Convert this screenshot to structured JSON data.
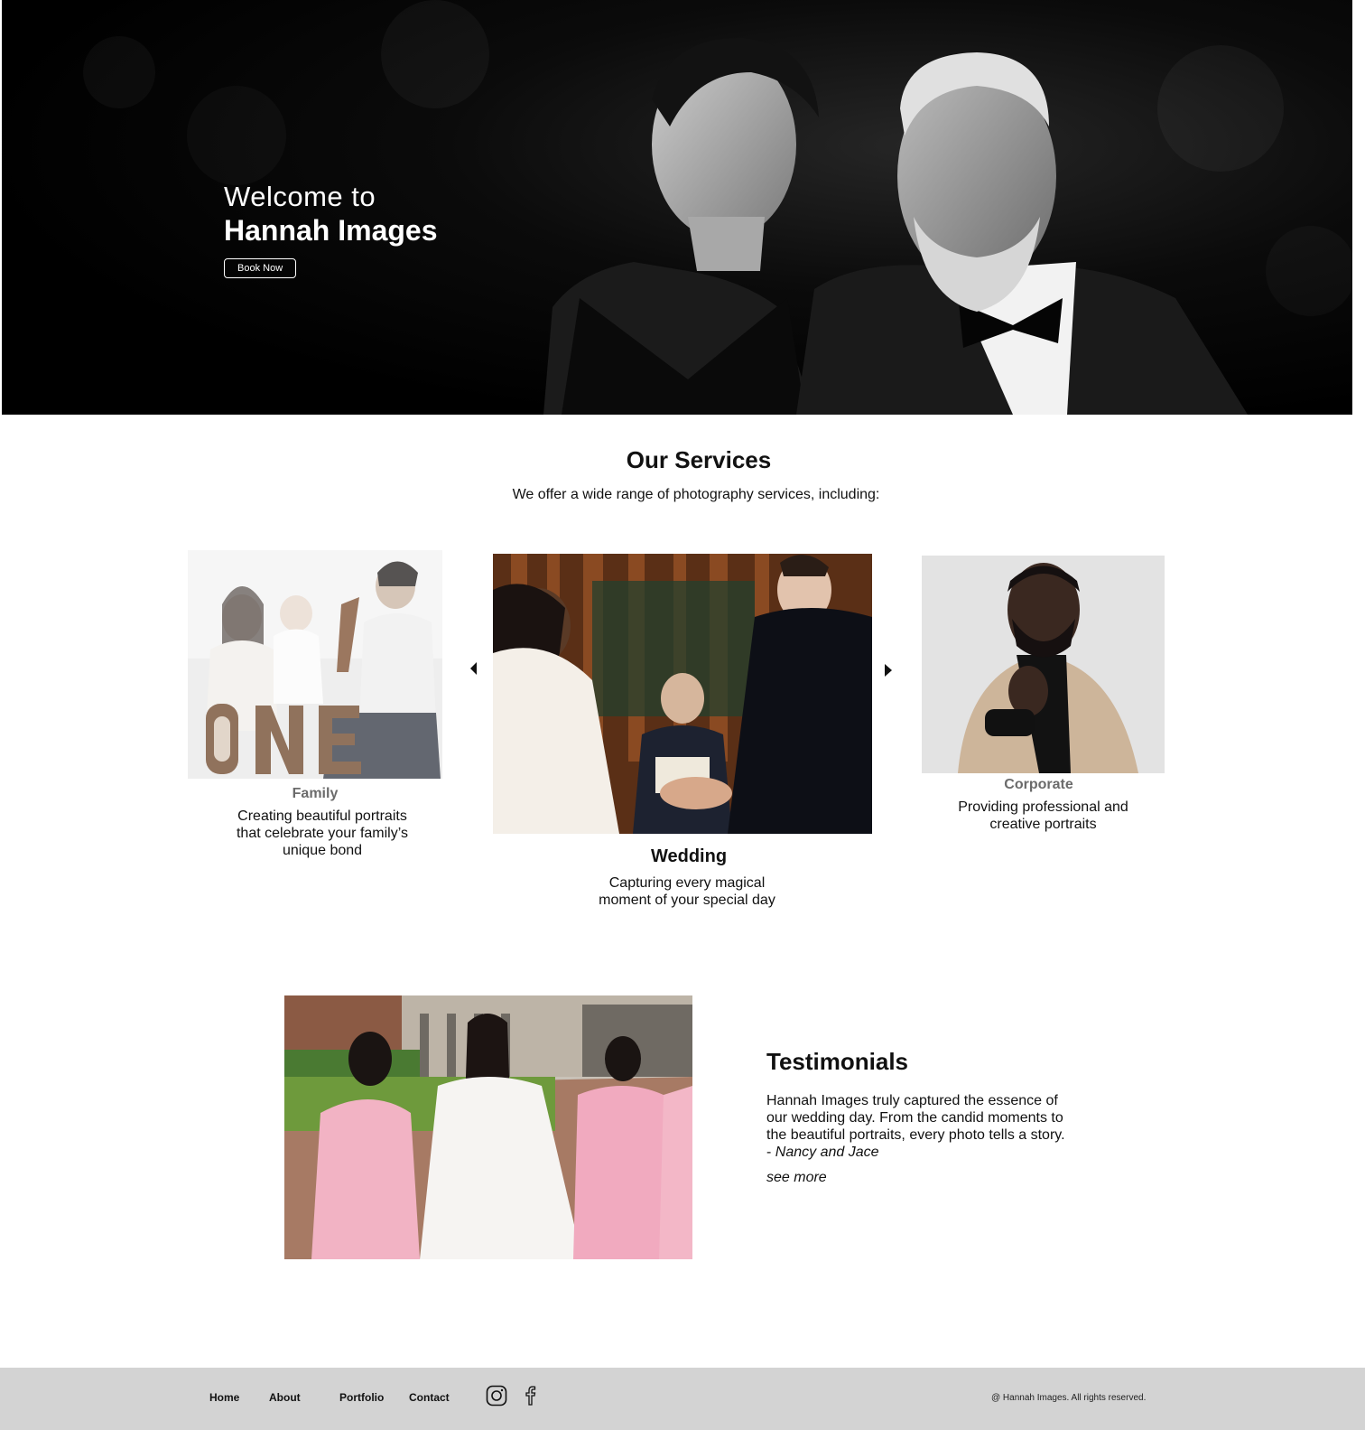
{
  "hero": {
    "welcome": "Welcome to",
    "brand": "Hannah Images",
    "book_label": "Book Now"
  },
  "services": {
    "title": "Our Services",
    "subtitle": "We offer a wide range of photography services, including:",
    "items": [
      {
        "label": "Family",
        "desc_lines": [
          "Creating beautiful portraits",
          "that celebrate your family’s",
          "unique bond"
        ]
      },
      {
        "label": "Wedding",
        "desc_lines": [
          "Capturing every magical",
          "moment of your special day"
        ]
      },
      {
        "label": "Corporate",
        "desc_lines": [
          "Providing professional and",
          "creative portraits"
        ]
      }
    ],
    "prev_icon": "caret-left-icon",
    "next_icon": "caret-right-icon"
  },
  "testimonials": {
    "title": "Testimonials",
    "quote": "Hannah Images truly captured the essence of our wedding day. From the candid moments to the beautiful portraits, every photo tells a story. - ",
    "author": "Nancy and Jace",
    "see_more": "see more"
  },
  "footer": {
    "nav": [
      "Home",
      "About",
      "Portfolio",
      "Contact"
    ],
    "social_icons": [
      "instagram-icon",
      "facebook-icon"
    ],
    "copyright": "@ Hannah Images. All rights reserved."
  },
  "colors": {
    "hero_bg": "#000000",
    "footer_bg": "#d3d3d3",
    "muted_label": "#6b6b6b"
  }
}
